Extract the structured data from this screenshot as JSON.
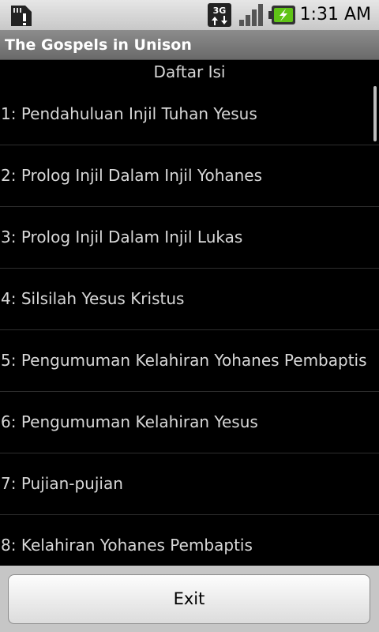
{
  "status_bar": {
    "network_type": "3G",
    "time": "1:31 AM"
  },
  "app": {
    "title": "The Gospels in Unison"
  },
  "toc": {
    "heading": "Daftar Isi",
    "items": [
      "1: Pendahuluan Injil Tuhan Yesus",
      "2: Prolog Injil Dalam Injil Yohanes",
      "3: Prolog Injil Dalam Injil Lukas",
      "4: Silsilah Yesus Kristus",
      "5: Pengumuman Kelahiran Yohanes Pembaptis",
      "6: Pengumuman Kelahiran Yesus",
      "7: Pujian-pujian",
      "8: Kelahiran Yohanes Pembaptis"
    ]
  },
  "footer": {
    "exit_label": "Exit"
  },
  "colors": {
    "background": "#000000",
    "list_text": "#d8d8d8",
    "title_bar": "#7a7a7a",
    "battery_green": "#5fc316"
  }
}
